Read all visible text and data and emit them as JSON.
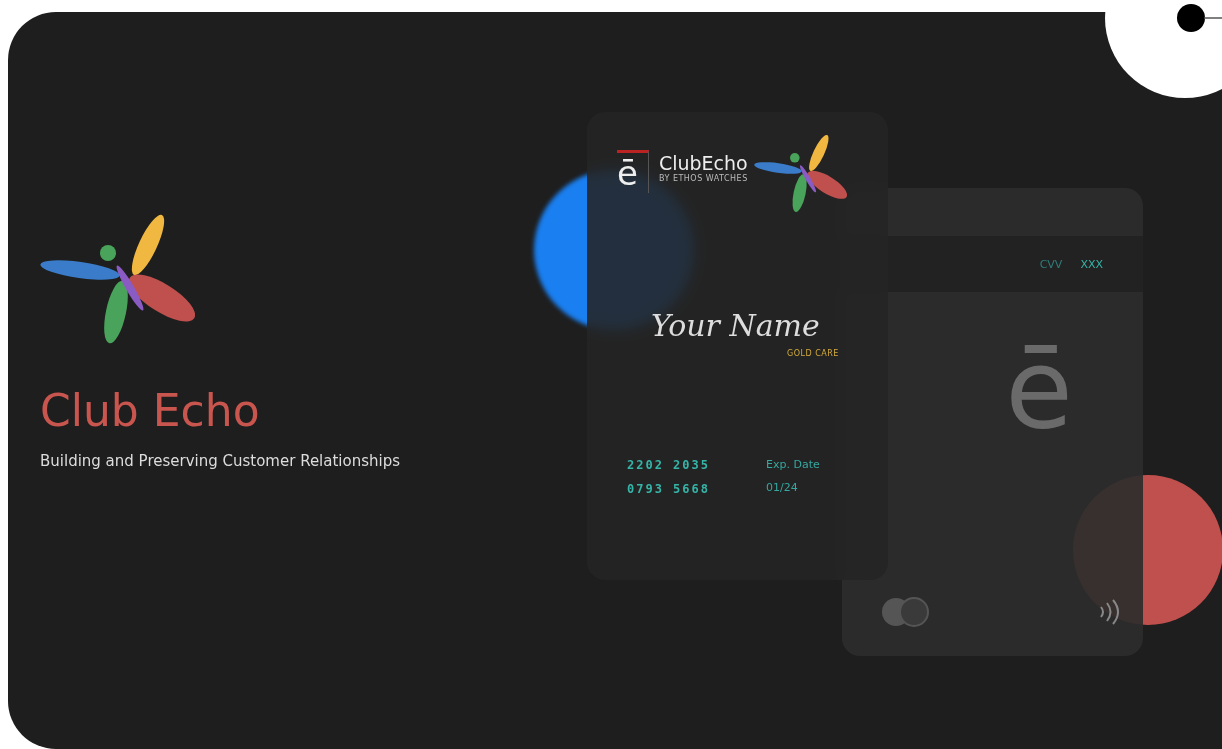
{
  "brand": {
    "title": "Club Echo",
    "subtitle": "Building and Preserving Customer Relationships"
  },
  "front_card": {
    "logo_letter": "ē",
    "brand_name": "ClubEcho",
    "brand_tagline": "BY ETHOS WATCHES",
    "holder_name": "Your Name",
    "tier": "GOLD CARE",
    "number_lines": [
      "2202 2035",
      "0793 5668"
    ],
    "expiry_label": "Exp. Date",
    "expiry_value": "01/24"
  },
  "back_card": {
    "cvv_label": "CVV",
    "cvv_value": "XXX",
    "logo_letter": "ē"
  }
}
